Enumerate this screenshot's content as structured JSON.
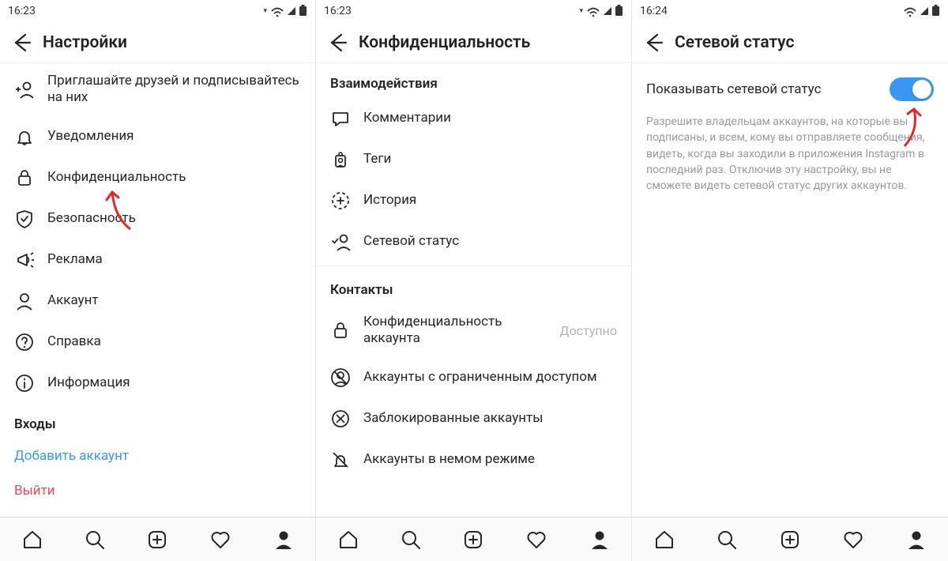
{
  "screen1": {
    "time": "16:23",
    "title": "Настройки",
    "items": [
      {
        "icon": "add-user",
        "label": "Приглашайте друзей и подписывайтесь на них"
      },
      {
        "icon": "bell",
        "label": "Уведомления"
      },
      {
        "icon": "lock",
        "label": "Конфиденциальность"
      },
      {
        "icon": "shield",
        "label": "Безопасность"
      },
      {
        "icon": "megaphone",
        "label": "Реклама"
      },
      {
        "icon": "user",
        "label": "Аккаунт"
      },
      {
        "icon": "help",
        "label": "Справка"
      },
      {
        "icon": "info",
        "label": "Информация"
      }
    ],
    "section_logins": "Входы",
    "add_account": "Добавить аккаунт",
    "logout": "Выйти"
  },
  "screen2": {
    "time": "16:23",
    "title": "Конфиденциальность",
    "section_interactions": "Взаимодействия",
    "interactions": [
      {
        "icon": "comment",
        "label": "Комментарии"
      },
      {
        "icon": "tag",
        "label": "Теги"
      },
      {
        "icon": "story",
        "label": "История"
      },
      {
        "icon": "activity",
        "label": "Сетевой статус"
      }
    ],
    "section_contacts": "Контакты",
    "contacts": [
      {
        "icon": "lock",
        "label": "Конфиденциальность аккаунта",
        "trail": "Доступно"
      },
      {
        "icon": "restricted",
        "label": "Аккаунты с ограниченным доступом"
      },
      {
        "icon": "blocked",
        "label": "Заблокированные аккаунты"
      },
      {
        "icon": "mute",
        "label": "Аккаунты в немом режиме"
      }
    ]
  },
  "screen3": {
    "time": "16:24",
    "title": "Сетевой статус",
    "toggle_label": "Показывать сетевой статус",
    "toggle_on": true,
    "description": "Разрешите владельцам аккаунтов, на которые вы подписаны, и всем, кому вы отправляете сообщения, видеть, когда вы заходили в приложения Instagram в последний раз. Отключив эту настройку, вы не сможете видеть сетевой статус других аккаунтов."
  }
}
